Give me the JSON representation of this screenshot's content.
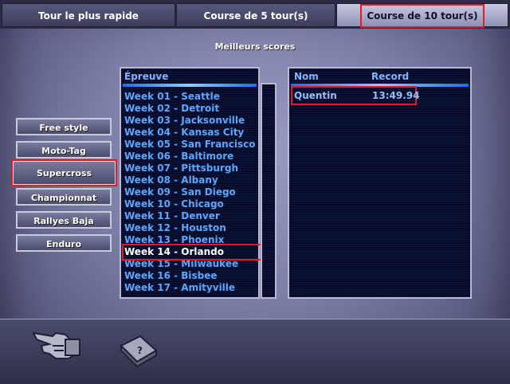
{
  "tabs": [
    {
      "label": "Tour le plus rapide"
    },
    {
      "label": "Course de 5 tour(s)"
    },
    {
      "label": "Course de 10 tour(s)"
    }
  ],
  "heading": "Meilleurs scores",
  "categories": [
    {
      "label": "Free style"
    },
    {
      "label": "Moto-Tag"
    },
    {
      "label": "Supercross"
    },
    {
      "label": "Championnat"
    },
    {
      "label": "Rallyes Baja"
    },
    {
      "label": "Enduro"
    }
  ],
  "events_header": "Épreuve",
  "events": [
    "Week 01 - Seattle",
    "Week 02 - Detroit",
    "Week 03 - Jacksonville",
    "Week 04 - Kansas City",
    "Week 05 - San Francisco",
    "Week 06 - Baltimore",
    "Week 07 - Pittsburgh",
    "Week 08 - Albany",
    "Week 09 - San Diego",
    "Week 10 - Chicago",
    "Week 11 - Denver",
    "Week 12 - Houston",
    "Week 13 - Phoenix",
    "Week 14 - Orlando",
    "Week 15 - Milwaukee",
    "Week 16 - Bisbee",
    "Week 17 - Amityville"
  ],
  "scores": {
    "col_name": "Nom",
    "col_record": "Record",
    "rows": [
      {
        "name": "Quentin",
        "record": "13:49.94"
      }
    ]
  },
  "bottom": {
    "back_icon": "pointing-hand-icon",
    "help_icon": "help-book-icon"
  }
}
